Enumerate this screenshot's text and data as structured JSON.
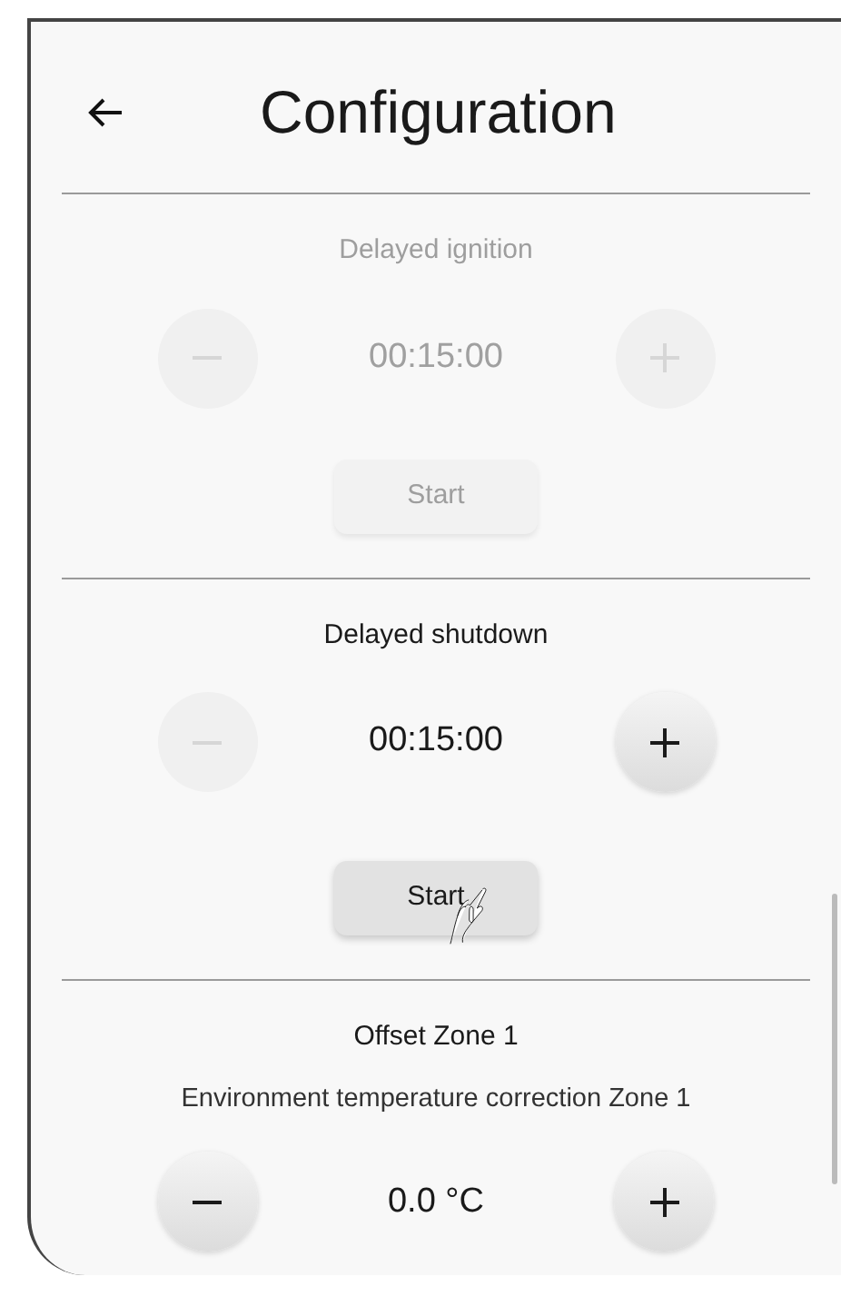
{
  "header": {
    "title": "Configuration"
  },
  "sections": [
    {
      "title": "Delayed ignition",
      "disabled": true,
      "value": "00:15:00",
      "minus_disabled": true,
      "plus_disabled": true,
      "start": {
        "label": "Start",
        "disabled": true
      }
    },
    {
      "title": "Delayed shutdown",
      "disabled": false,
      "value": "00:15:00",
      "minus_disabled": true,
      "plus_disabled": false,
      "start": {
        "label": "Start",
        "disabled": false
      }
    },
    {
      "title": "Offset Zone 1",
      "subtitle": "Environment temperature correction Zone 1",
      "disabled": false,
      "value": "0.0 °C",
      "minus_disabled": false,
      "plus_disabled": false
    }
  ]
}
